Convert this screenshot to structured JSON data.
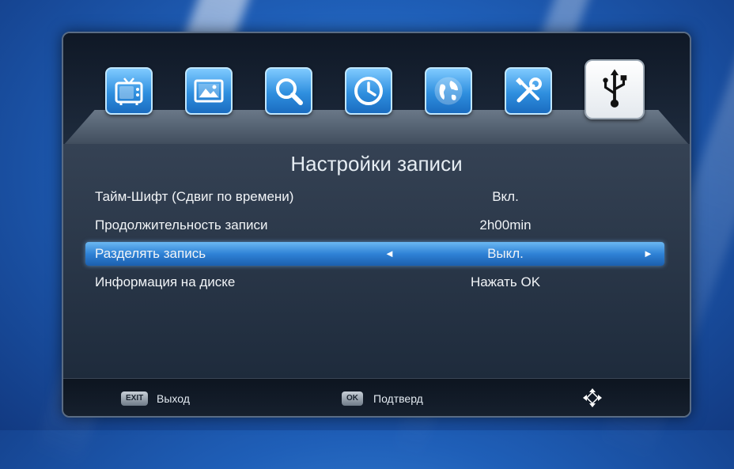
{
  "screen": {
    "title": "Настройки записи"
  },
  "menu_icons": [
    {
      "name": "tv-icon",
      "active": false
    },
    {
      "name": "picture-icon",
      "active": false
    },
    {
      "name": "search-icon",
      "active": false
    },
    {
      "name": "clock-icon",
      "active": false
    },
    {
      "name": "globe-icon",
      "active": false
    },
    {
      "name": "tools-icon",
      "active": false
    },
    {
      "name": "usb-icon",
      "active": true
    }
  ],
  "settings": [
    {
      "label": "Тайм-Шифт (Сдвиг по времени)",
      "value": "Вкл."
    },
    {
      "label": "Продолжительность записи",
      "value": "2h00min"
    },
    {
      "label": "Разделять запись",
      "value": "Выкл.",
      "selected": true
    },
    {
      "label": "Информация на диске",
      "value": "Нажать OK"
    }
  ],
  "footer": {
    "exit_key": "EXIT",
    "exit_label": "Выход",
    "ok_key": "OK",
    "ok_label": "Подтверд"
  },
  "colors": {
    "highlight": "#2f82d6",
    "tile": "#2f8fdf",
    "background": "#1f5fb8"
  }
}
